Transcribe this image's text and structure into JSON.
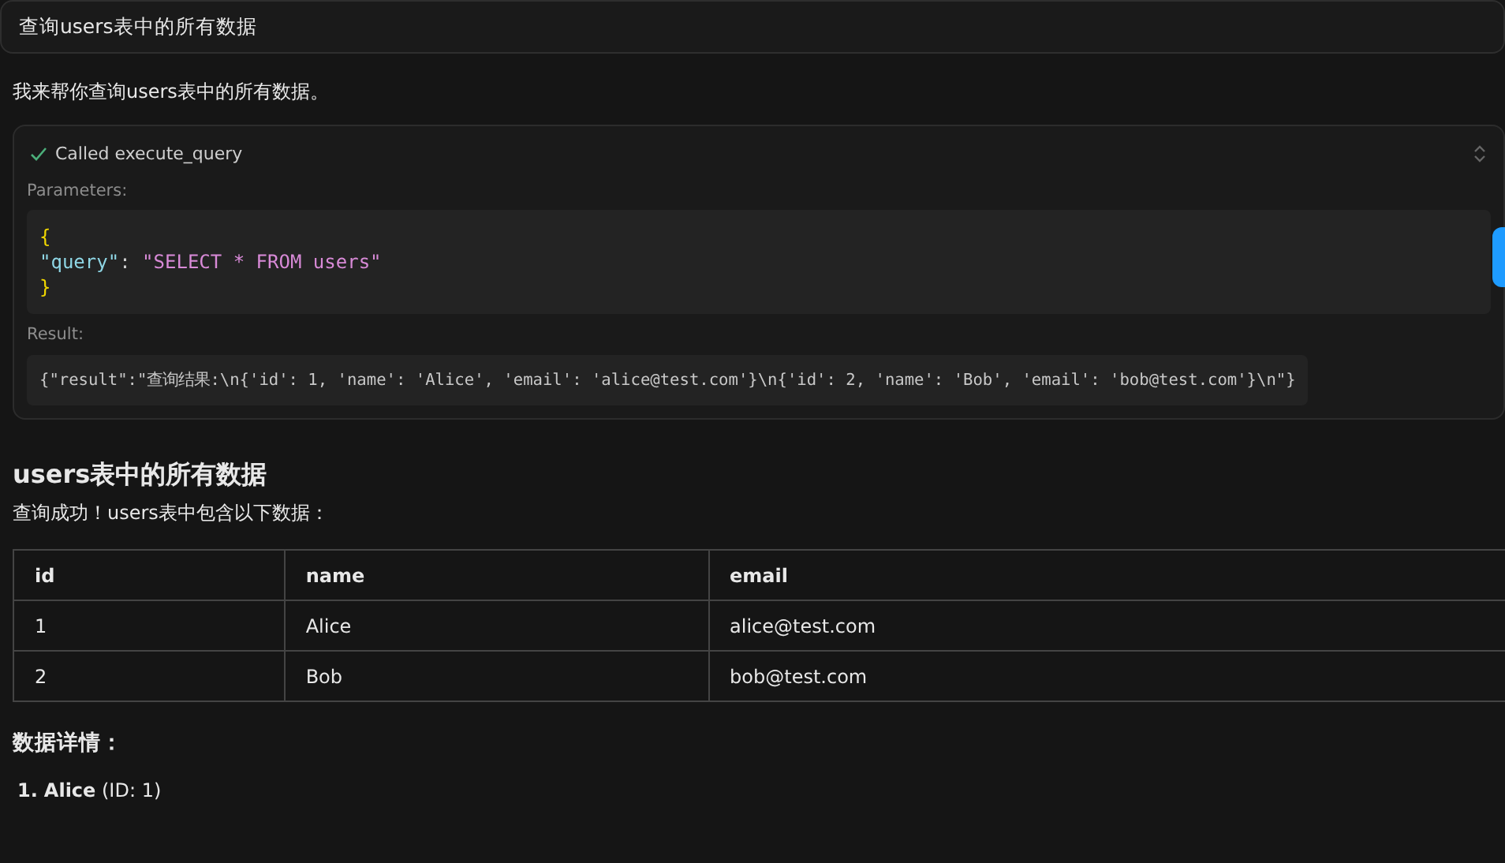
{
  "user_message": "查询users表中的所有数据",
  "assistant_intro": "我来帮你查询users表中的所有数据。",
  "tool_call": {
    "done": true,
    "label": "Called execute_query",
    "expanded": true,
    "parameters_label": "Parameters:",
    "parameters": {
      "open": "{",
      "key": "\"query\"",
      "separator": ":",
      "value": "\"SELECT * FROM users\"",
      "close": "}"
    },
    "result_label": "Result:",
    "result": "{\"result\":\"查询结果:\\n{'id': 1, 'name': 'Alice', 'email': 'alice@test.com'}\\n{'id': 2, 'name': 'Bob', 'email': 'bob@test.com'}\\n\"}"
  },
  "heading": "users表中的所有数据",
  "summary": "查询成功！users表中包含以下数据：",
  "table": {
    "columns": [
      "id",
      "name",
      "email"
    ],
    "rows": [
      [
        "1",
        "Alice",
        "alice@test.com"
      ],
      [
        "2",
        "Bob",
        "bob@test.com"
      ]
    ]
  },
  "details_heading": "数据详情：",
  "details": [
    {
      "marker": "1.",
      "text": "**Alice** (ID: 1)"
    }
  ]
}
